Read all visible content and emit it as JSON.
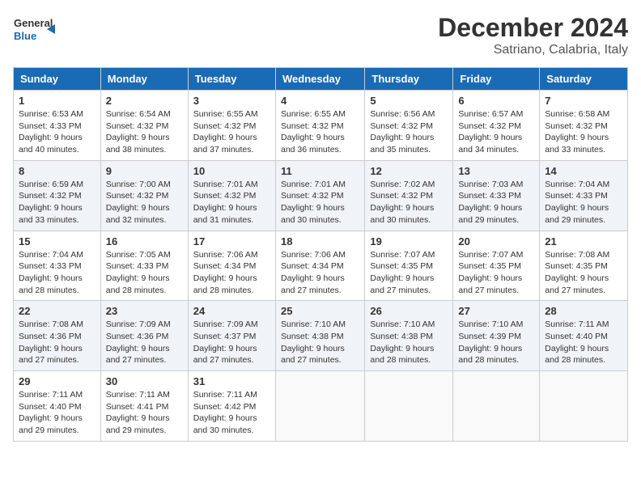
{
  "header": {
    "logo_line1": "General",
    "logo_line2": "Blue",
    "month_year": "December 2024",
    "location": "Satriano, Calabria, Italy"
  },
  "weekdays": [
    "Sunday",
    "Monday",
    "Tuesday",
    "Wednesday",
    "Thursday",
    "Friday",
    "Saturday"
  ],
  "weeks": [
    [
      {
        "day": "1",
        "sunrise": "6:53 AM",
        "sunset": "4:33 PM",
        "daylight": "9 hours and 40 minutes."
      },
      {
        "day": "2",
        "sunrise": "6:54 AM",
        "sunset": "4:32 PM",
        "daylight": "9 hours and 38 minutes."
      },
      {
        "day": "3",
        "sunrise": "6:55 AM",
        "sunset": "4:32 PM",
        "daylight": "9 hours and 37 minutes."
      },
      {
        "day": "4",
        "sunrise": "6:55 AM",
        "sunset": "4:32 PM",
        "daylight": "9 hours and 36 minutes."
      },
      {
        "day": "5",
        "sunrise": "6:56 AM",
        "sunset": "4:32 PM",
        "daylight": "9 hours and 35 minutes."
      },
      {
        "day": "6",
        "sunrise": "6:57 AM",
        "sunset": "4:32 PM",
        "daylight": "9 hours and 34 minutes."
      },
      {
        "day": "7",
        "sunrise": "6:58 AM",
        "sunset": "4:32 PM",
        "daylight": "9 hours and 33 minutes."
      }
    ],
    [
      {
        "day": "8",
        "sunrise": "6:59 AM",
        "sunset": "4:32 PM",
        "daylight": "9 hours and 33 minutes."
      },
      {
        "day": "9",
        "sunrise": "7:00 AM",
        "sunset": "4:32 PM",
        "daylight": "9 hours and 32 minutes."
      },
      {
        "day": "10",
        "sunrise": "7:01 AM",
        "sunset": "4:32 PM",
        "daylight": "9 hours and 31 minutes."
      },
      {
        "day": "11",
        "sunrise": "7:01 AM",
        "sunset": "4:32 PM",
        "daylight": "9 hours and 30 minutes."
      },
      {
        "day": "12",
        "sunrise": "7:02 AM",
        "sunset": "4:32 PM",
        "daylight": "9 hours and 30 minutes."
      },
      {
        "day": "13",
        "sunrise": "7:03 AM",
        "sunset": "4:33 PM",
        "daylight": "9 hours and 29 minutes."
      },
      {
        "day": "14",
        "sunrise": "7:04 AM",
        "sunset": "4:33 PM",
        "daylight": "9 hours and 29 minutes."
      }
    ],
    [
      {
        "day": "15",
        "sunrise": "7:04 AM",
        "sunset": "4:33 PM",
        "daylight": "9 hours and 28 minutes."
      },
      {
        "day": "16",
        "sunrise": "7:05 AM",
        "sunset": "4:33 PM",
        "daylight": "9 hours and 28 minutes."
      },
      {
        "day": "17",
        "sunrise": "7:06 AM",
        "sunset": "4:34 PM",
        "daylight": "9 hours and 28 minutes."
      },
      {
        "day": "18",
        "sunrise": "7:06 AM",
        "sunset": "4:34 PM",
        "daylight": "9 hours and 27 minutes."
      },
      {
        "day": "19",
        "sunrise": "7:07 AM",
        "sunset": "4:35 PM",
        "daylight": "9 hours and 27 minutes."
      },
      {
        "day": "20",
        "sunrise": "7:07 AM",
        "sunset": "4:35 PM",
        "daylight": "9 hours and 27 minutes."
      },
      {
        "day": "21",
        "sunrise": "7:08 AM",
        "sunset": "4:35 PM",
        "daylight": "9 hours and 27 minutes."
      }
    ],
    [
      {
        "day": "22",
        "sunrise": "7:08 AM",
        "sunset": "4:36 PM",
        "daylight": "9 hours and 27 minutes."
      },
      {
        "day": "23",
        "sunrise": "7:09 AM",
        "sunset": "4:36 PM",
        "daylight": "9 hours and 27 minutes."
      },
      {
        "day": "24",
        "sunrise": "7:09 AM",
        "sunset": "4:37 PM",
        "daylight": "9 hours and 27 minutes."
      },
      {
        "day": "25",
        "sunrise": "7:10 AM",
        "sunset": "4:38 PM",
        "daylight": "9 hours and 27 minutes."
      },
      {
        "day": "26",
        "sunrise": "7:10 AM",
        "sunset": "4:38 PM",
        "daylight": "9 hours and 28 minutes."
      },
      {
        "day": "27",
        "sunrise": "7:10 AM",
        "sunset": "4:39 PM",
        "daylight": "9 hours and 28 minutes."
      },
      {
        "day": "28",
        "sunrise": "7:11 AM",
        "sunset": "4:40 PM",
        "daylight": "9 hours and 28 minutes."
      }
    ],
    [
      {
        "day": "29",
        "sunrise": "7:11 AM",
        "sunset": "4:40 PM",
        "daylight": "9 hours and 29 minutes."
      },
      {
        "day": "30",
        "sunrise": "7:11 AM",
        "sunset": "4:41 PM",
        "daylight": "9 hours and 29 minutes."
      },
      {
        "day": "31",
        "sunrise": "7:11 AM",
        "sunset": "4:42 PM",
        "daylight": "9 hours and 30 minutes."
      },
      null,
      null,
      null,
      null
    ]
  ]
}
